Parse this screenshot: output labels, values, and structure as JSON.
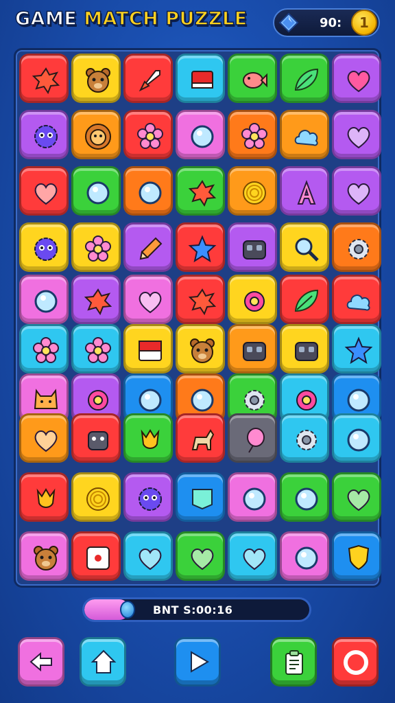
{
  "header": {
    "title_part1": "GAME",
    "title_part2": "MATCH",
    "title_part3": "PUZZLE",
    "score": "90:",
    "coin_value": "1"
  },
  "board": {
    "rows": [
      [
        {
          "color": "#ff3b3b",
          "icon": "splat"
        },
        {
          "color": "#ffd51f",
          "icon": "bear"
        },
        {
          "color": "#ff3b3b",
          "icon": "rocket"
        },
        {
          "color": "#2fc7f0",
          "icon": "red-flag"
        },
        {
          "color": "#3bd13b",
          "icon": "fish"
        },
        {
          "color": "#3bd13b",
          "icon": "leaf"
        },
        {
          "color": "#b45af0",
          "icon": "heart-gem"
        }
      ],
      [
        {
          "color": "#b45af0",
          "icon": "blob-monster"
        },
        {
          "color": "#ff9a1a",
          "icon": "lion"
        },
        {
          "color": "#ff3b3b",
          "icon": "flower"
        },
        {
          "color": "#f070e0",
          "icon": "circle"
        },
        {
          "color": "#ff7a1a",
          "icon": "flower"
        },
        {
          "color": "#ff9a1a",
          "icon": "cloud"
        },
        {
          "color": "#b45af0",
          "icon": "heart"
        }
      ],
      [
        {
          "color": "#ff3b3b",
          "icon": "heart"
        },
        {
          "color": "#3bd13b",
          "icon": "circle"
        },
        {
          "color": "#ff7a1a",
          "icon": "circle"
        },
        {
          "color": "#3bd13b",
          "icon": "splat"
        },
        {
          "color": "#ff9a1a",
          "icon": "spiral"
        },
        {
          "color": "#b45af0",
          "icon": "letter-a"
        },
        {
          "color": "#b45af0",
          "icon": "heart"
        }
      ],
      [
        {
          "color": "#ffd51f",
          "icon": "blob-monster"
        },
        {
          "color": "#ffd51f",
          "icon": "flower"
        },
        {
          "color": "#b45af0",
          "icon": "pencil"
        },
        {
          "color": "#ff3b3b",
          "icon": "star"
        },
        {
          "color": "#b45af0",
          "icon": "robot"
        },
        {
          "color": "#ffd51f",
          "icon": "magnifier"
        },
        {
          "color": "#ff7a1a",
          "icon": "gear"
        }
      ],
      [
        {
          "color": "#f070e0",
          "icon": "circle"
        },
        {
          "color": "#b45af0",
          "icon": "splat"
        },
        {
          "color": "#f070e0",
          "icon": "heart"
        },
        {
          "color": "#ff3b3b",
          "icon": "splat"
        },
        {
          "color": "#ffd51f",
          "icon": "ring"
        },
        {
          "color": "#ff3b3b",
          "icon": "leaf"
        },
        {
          "color": "#ff3b3b",
          "icon": "cloud"
        }
      ],
      [
        {
          "color": "#2fc7f0",
          "icon": "flower"
        },
        {
          "color": "#2fc7f0",
          "icon": "flower"
        },
        {
          "color": "#ffd51f",
          "icon": "red-square"
        },
        {
          "color": "#ffd51f",
          "icon": "bear"
        },
        {
          "color": "#ff9a1a",
          "icon": "robot"
        },
        {
          "color": "#ffd51f",
          "icon": "robot"
        },
        {
          "color": "#2fc7f0",
          "icon": "star"
        }
      ],
      [
        {
          "color": "#f070e0",
          "icon": "cat"
        },
        {
          "color": "#b45af0",
          "icon": "ring"
        },
        {
          "color": "#1e8ff0",
          "icon": "circle"
        },
        {
          "color": "#ff7a1a",
          "icon": "circle"
        },
        {
          "color": "#3bd13b",
          "icon": "gear"
        },
        {
          "color": "#2fc7f0",
          "icon": "ring"
        },
        {
          "color": "#1e8ff0",
          "icon": "circle"
        }
      ],
      [
        {
          "color": "#ff9a1a",
          "icon": "heart"
        },
        {
          "color": "#ff3b3b",
          "icon": "monster"
        },
        {
          "color": "#3bd13b",
          "icon": "tulip"
        },
        {
          "color": "#ff3b3b",
          "icon": "dog"
        },
        {
          "color": "#6a6a78",
          "icon": "balloon"
        },
        {
          "color": "#2fc7f0",
          "icon": "gear"
        },
        {
          "color": "#2fc7f0",
          "icon": "circle"
        }
      ],
      [
        {
          "color": "#ff3b3b",
          "icon": "tulip"
        },
        {
          "color": "#ffd51f",
          "icon": "spiral"
        },
        {
          "color": "#b45af0",
          "icon": "blob-monster"
        },
        {
          "color": "#1e8ff0",
          "icon": "flag"
        },
        {
          "color": "#f070e0",
          "icon": "circle"
        },
        {
          "color": "#3bd13b",
          "icon": "circle"
        },
        {
          "color": "#3bd13b",
          "icon": "heart"
        }
      ],
      [
        {
          "color": "#f070e0",
          "icon": "bear"
        },
        {
          "color": "#ff3b3b",
          "icon": "dice"
        },
        {
          "color": "#2fc7f0",
          "icon": "heart"
        },
        {
          "color": "#3bd13b",
          "icon": "heart"
        },
        {
          "color": "#2fc7f0",
          "icon": "heart"
        },
        {
          "color": "#f070e0",
          "icon": "circle"
        },
        {
          "color": "#1e8ff0",
          "icon": "shield"
        }
      ]
    ]
  },
  "progress": {
    "label": "BNT S:00:16",
    "fraction": 0.2
  },
  "controls": [
    {
      "icon": "back-arrow-icon",
      "color": "#f070e0"
    },
    {
      "icon": "home-icon",
      "color": "#2fc7f0"
    },
    {
      "icon": "play-icon",
      "color": "#1e8ff0"
    },
    {
      "icon": "clipboard-icon",
      "color": "#3bd13b"
    },
    {
      "icon": "record-icon",
      "color": "#ff3b3b"
    }
  ]
}
